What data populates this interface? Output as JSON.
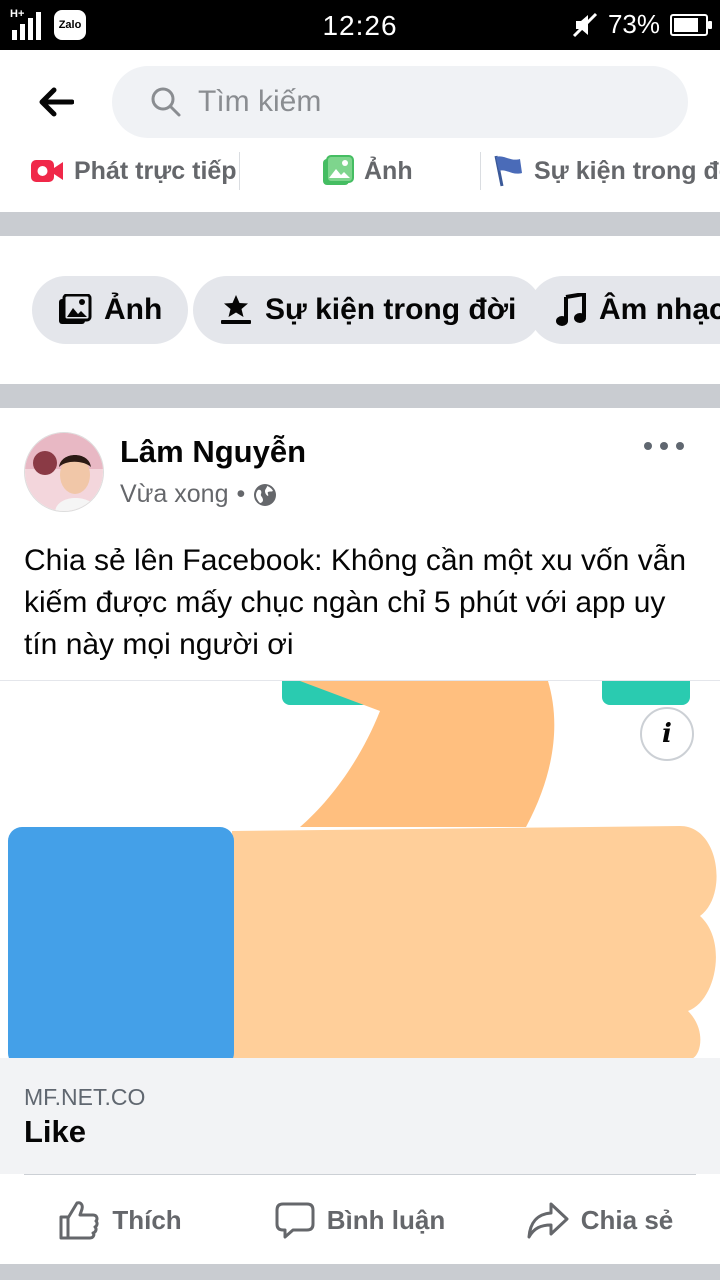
{
  "status_bar": {
    "network": "H+",
    "zalo_label": "Zalo",
    "time": "12:26",
    "battery": "73%"
  },
  "search": {
    "placeholder": "Tìm kiếm"
  },
  "composer_actions": [
    {
      "label": "Phát trực tiếp",
      "icon": "live-video-icon",
      "color": "#f02849"
    },
    {
      "label": "Ảnh",
      "icon": "photo-icon",
      "color": "#45bd62"
    },
    {
      "label": "Sự kiện trong đời",
      "icon": "flag-icon",
      "color": "#3b5998"
    }
  ],
  "chips": [
    {
      "label": "Ảnh",
      "icon": "photo-icon"
    },
    {
      "label": "Sự kiện trong đời",
      "icon": "star-podium-icon"
    },
    {
      "label": "Âm nhạc",
      "icon": "music-note-icon"
    }
  ],
  "post": {
    "author": "Lâm Nguyễn",
    "time": "Vừa xong",
    "privacy_icon": "globe-icon",
    "text": "Chia sẻ lên Facebook: Không cần một xu vốn vẫn kiếm được mấy chục ngàn chỉ 5 phút với app uy tín này mọi người ơi",
    "link": {
      "domain": "MF.NET.CO",
      "title": "Like"
    },
    "actions": [
      {
        "label": "Thích",
        "icon": "thumbs-up-icon"
      },
      {
        "label": "Bình luận",
        "icon": "comment-icon"
      },
      {
        "label": "Chia sẻ",
        "icon": "share-icon"
      }
    ]
  },
  "colors": {
    "accent_blue": "#1877f2",
    "thumb_skin": "#ffcf9a",
    "thumb_shade": "#ffbf7f",
    "cuff_blue": "#44a0e8",
    "teal": "#2acbb0"
  }
}
